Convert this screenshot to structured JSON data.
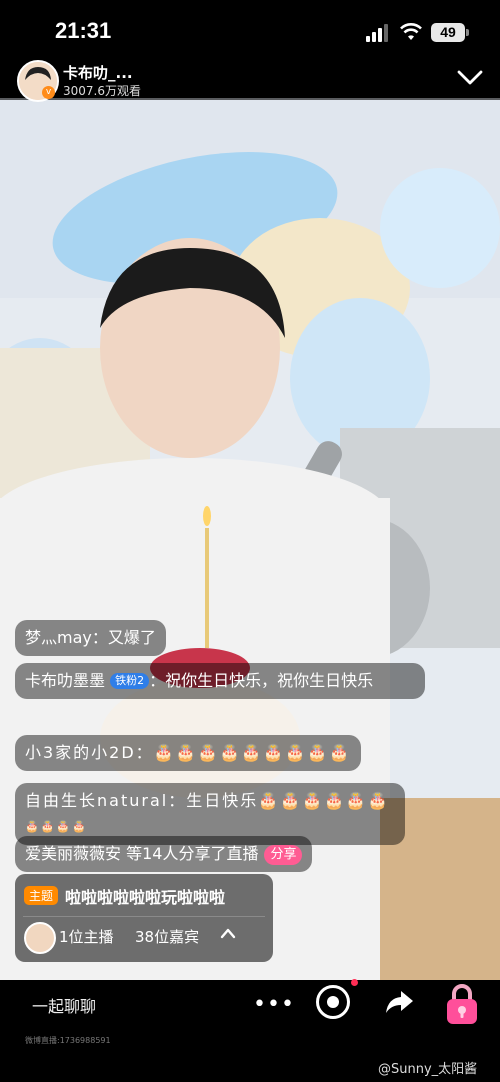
{
  "status": {
    "time": "21:31",
    "battery": "49"
  },
  "header": {
    "host_name": "卡布叻_...",
    "viewers": "3007.6万观看"
  },
  "chat": [
    {
      "nick": "梦灬may：",
      "text": "又爆了"
    },
    {
      "nick": "卡布叻墨墨",
      "badge": "铁粉2",
      "text": "：祝你生日快乐，祝你生日快乐"
    },
    {
      "nick": "小3家的小2D：",
      "text": "🎂🎂🎂🎂🎂🎂🎂🎂🎂"
    },
    {
      "nick": "自由生长natural：",
      "text": "生日快乐🎂🎂🎂🎂🎂🎂"
    },
    {
      "nick": "",
      "text": "🎂🎂🎂🎂"
    },
    {
      "nick": "爱美丽薇薇安",
      "text": " 等14人分享了直播",
      "action": "分享"
    }
  ],
  "topic": {
    "tag": "主题",
    "text": "啦啦啦啦啦啦玩啦啦啦",
    "hosts": "1位主播",
    "guests": "38位嘉宾"
  },
  "bottom": {
    "chat_placeholder": "一起聊聊",
    "more": "•••"
  },
  "watermark": {
    "left": "微博直播:1736988591",
    "right": "@Sunny_太阳酱"
  },
  "colors": {
    "accent_orange": "#ff8a00",
    "fan_badge": "#2f7ee8",
    "share_pink": "#ff5c93"
  }
}
